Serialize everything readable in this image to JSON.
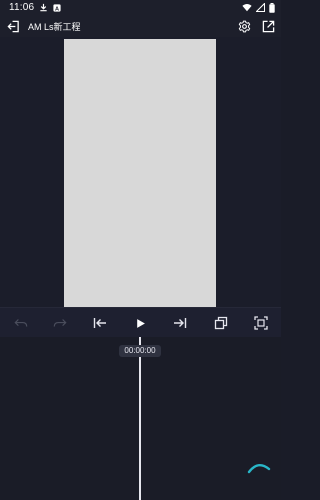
{
  "status_bar": {
    "time": "11:06",
    "icons": [
      "download-icon",
      "notification-a-icon",
      "wifi-icon",
      "signal-icon",
      "battery-icon"
    ]
  },
  "header": {
    "title": "AM Ls新工程",
    "back_icon": "exit-arrow-icon",
    "settings_icon": "gear-icon",
    "export_icon": "share-out-icon"
  },
  "preview": {
    "canvas_color": "#d8d8d8"
  },
  "toolbar": {
    "icons": [
      "undo-icon",
      "redo-icon",
      "skip-to-start-icon",
      "play-icon",
      "skip-to-end-icon",
      "crop-rotate-icon",
      "fullscreen-icon"
    ]
  },
  "timeline": {
    "current_time": "00:00:00"
  },
  "colors": {
    "background": "#1a1c28",
    "accent": "#29b6c8",
    "disabled_icon": "#4a4d5c"
  }
}
